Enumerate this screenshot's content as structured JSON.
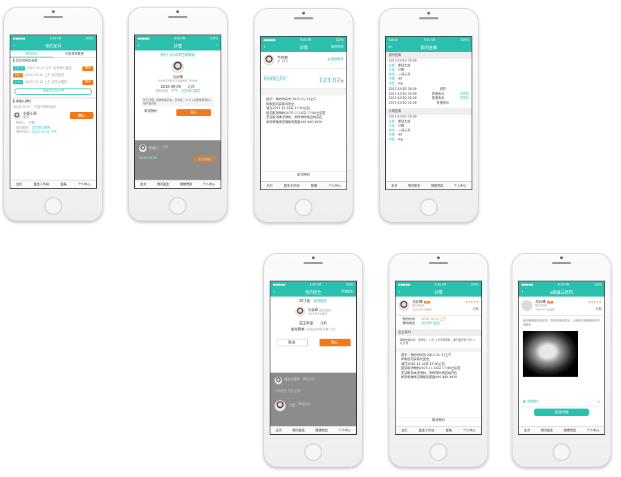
{
  "status": {
    "time": "9:08 AM",
    "time2": "9:41 AM",
    "battery": "100%",
    "carrier": "Sketch"
  },
  "tabbar": {
    "home": "主页",
    "workstation": "医生工作站",
    "my_doctor": "我的医生",
    "advice": "医嘱",
    "records": "健康档案",
    "me": "个人中心"
  },
  "p1": {
    "title": "预约加号",
    "tab_mine": "我的出诊",
    "tab_other": "科室其他医生",
    "section_time": "出诊时间及号源",
    "slots": [
      {
        "tag": "上午 10",
        "text": "2015-10-12 上午  北京博仁医院",
        "btn": "加号"
      },
      {
        "tag": "下午 1",
        "text": "2015-10-12 上午  北京医院",
        "btn": ""
      },
      {
        "tag": "上午 2",
        "text": "2015-10-12 上午  北京大医院",
        "btn": "加号"
      }
    ],
    "setting": "设置出诊及号源",
    "section_confirm": "待确认预约",
    "date": "2015-10-07",
    "dept_title": "科室内预约加号",
    "patient": "令狐小翠",
    "patient_sub": "患病",
    "confirm": "确认",
    "labels": [
      "申请人：",
      "就诊医院：",
      "预约时间："
    ],
    "values": [
      "王哥",
      "北京博仁医院",
      "2015-10-16 下午"
    ]
  },
  "p2": {
    "title": "详情",
    "modal_title": "预约门诊请求已被接受",
    "doc_name": "马云峰",
    "doc_sub": "北大医学院附属五附属医院  主任医师",
    "date": "2015-09-09",
    "dept": "儿科",
    "time_label": "预约时间",
    "time_val": "下午",
    "hospital": "北京博仁医院",
    "note": "医生叮嘱：请携带病历本，身份证，CT片 X光影像等资料，请不要迟到",
    "cancel": "取消预约",
    "ok": "确认",
    "bg_name": "李春江",
    "bg_tag": "儿科",
    "bg_date": "2015-09-09",
    "bg_btn": "取消预约"
  },
  "p3": {
    "title": "详情",
    "right": "联系患者",
    "patient": "牛莉莉",
    "patient_sub": "女  34岁",
    "records": "健康档案",
    "date": "2015-09-07 19:20",
    "paid": "预约费用已支付",
    "amount": "123.02",
    "unit": "元",
    "tip_lines": [
      "提示：预约时间为 2015-11-17上午",
      "如果您的安排有变化",
      "请在2015-11-16日 17:00之前",
      "提前取消预约2015-11-16日 17:00之前若",
      "无法取消本次预约。到时预约将自动开启",
      "如有特殊情况请联系客服400 880 9920"
    ],
    "cancel": "取消预约"
  },
  "p4": {
    "title": "我的医嘱",
    "sect_temp": "临时医嘱",
    "sect_long": "长期医嘱",
    "dates": [
      "2015-10-10  10:00"
    ],
    "fields": [
      [
        "名称",
        "莱巴土坐"
      ],
      [
        "方式",
        "口服"
      ],
      [
        "频率",
        "一日三次"
      ],
      [
        "剂量",
        "30"
      ],
      [
        "单位",
        "mg"
      ]
    ],
    "items": [
      {
        "d": "2015-10-10  10:00",
        "t": "退药",
        "s": ""
      },
      {
        "d": "2015-10-10  10:00",
        "t": "普通会诊",
        "s": "已完成"
      },
      {
        "d": "2015-10-10  10:00",
        "t": "普通会诊",
        "s": "已停诊"
      },
      {
        "d": "2015-10-10  10:00",
        "t": "普通会诊",
        "s": ""
      }
    ]
  },
  "p5": {
    "title": "我的医生",
    "right": "其他医生",
    "tabs": [
      "四寸谈",
      "咨询服务"
    ],
    "doc_name": "马云峰",
    "doc_badge": "副主任医师",
    "doc_sub": "北京大学人民医院",
    "dept_label": "医生科室",
    "dept_val": "儿科",
    "fee_label": "咨询费用",
    "fee_note": "(已超过咨询次数 1次)",
    "cancel": "取消",
    "ok": "确认",
    "bg": [
      {
        "name": "副主任医师",
        "dept": "神经内科"
      },
      {
        "name": "王莹",
        "dept": "神经内科"
      }
    ],
    "bg_sect": "儿科医生  内外全科",
    "side_tag": "咨询服务"
  },
  "p6": {
    "title": "详情",
    "doc_name": "马云峰",
    "doc_title": "副主任医师",
    "doc_hosp": "北京大学人民医院",
    "doc_dept": "儿科",
    "time_label": "预约时间",
    "time_val": "2015-10-15 上午",
    "place_label": "预约地点",
    "place_val": "北京博仁医院",
    "sect": "医生嘱咐",
    "note": "请携带病历本、身份证、CT片 X光片等资料，请不要迟到 约为 X光 片等",
    "tip_lines": [
      "提示：预约时间为 2015-11-17上午",
      "如果您的安排有变化",
      "请在2015-11-16日 17:00之前",
      "提前取消预约2015-11-16日 17:00之前若",
      "无法取消本次预约。到时预约将自动开启",
      "如有特殊情况请联系客服400 880 9920"
    ],
    "cancel": "取消预约"
  },
  "p7": {
    "title": "e路康云医院",
    "doc_name": "马云峰",
    "doc_sub": "副主任医师",
    "doc_hosp": "北京大学人民医院",
    "doc_dept": "儿科",
    "question": "请详细描述您的症状、疾病和身体状况，以便医生能够更好的为您解答",
    "add_image": "添加图片",
    "send": "发送问题"
  }
}
